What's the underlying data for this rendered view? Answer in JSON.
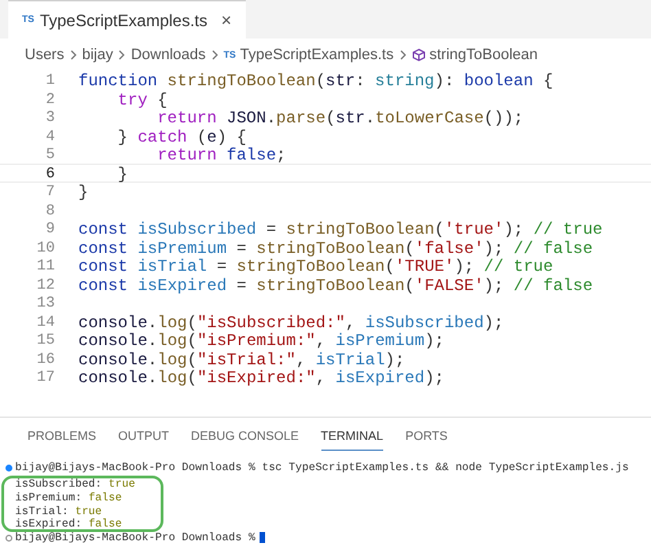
{
  "editor_tab": {
    "icon_text": "TS",
    "label": "TypeScriptExamples.ts",
    "close": "×",
    "selected": true
  },
  "breadcrumb": [
    {
      "kind": "text",
      "label": "Users"
    },
    {
      "kind": "text",
      "label": "bijay"
    },
    {
      "kind": "text",
      "label": "Downloads"
    },
    {
      "kind": "file",
      "icon_text": "TS",
      "label": "TypeScriptExamples.ts"
    },
    {
      "kind": "symbol",
      "label": "stringToBoolean"
    }
  ],
  "code_lines": [
    {
      "number": "1",
      "current": false,
      "tokens": [
        {
          "kind": "kw",
          "text": "function"
        },
        {
          "kind": "fn",
          "text": " stringToBoolean"
        },
        {
          "kind": "plain",
          "text": "("
        },
        {
          "kind": "var",
          "text": "str"
        },
        {
          "kind": "plain",
          "text": ": "
        },
        {
          "kind": "type",
          "text": "string"
        },
        {
          "kind": "plain",
          "text": "): "
        },
        {
          "kind": "kw",
          "text": "boolean"
        },
        {
          "kind": "plain",
          "text": " {"
        }
      ]
    },
    {
      "number": "2",
      "current": false,
      "tokens": [
        {
          "kind": "ctrl",
          "text": "    try"
        },
        {
          "kind": "plain",
          "text": " {"
        }
      ]
    },
    {
      "number": "3",
      "current": false,
      "tokens": [
        {
          "kind": "ctrl",
          "text": "        return"
        },
        {
          "kind": "var",
          "text": " JSON"
        },
        {
          "kind": "plain",
          "text": "."
        },
        {
          "kind": "fn",
          "text": "parse"
        },
        {
          "kind": "plain",
          "text": "("
        },
        {
          "kind": "var",
          "text": "str"
        },
        {
          "kind": "plain",
          "text": "."
        },
        {
          "kind": "fn",
          "text": "toLowerCase"
        },
        {
          "kind": "plain",
          "text": "());"
        }
      ]
    },
    {
      "number": "4",
      "current": false,
      "tokens": [
        {
          "kind": "plain",
          "text": "    } "
        },
        {
          "kind": "ctrl",
          "text": "catch"
        },
        {
          "kind": "plain",
          "text": " ("
        },
        {
          "kind": "var",
          "text": "e"
        },
        {
          "kind": "plain",
          "text": ") {"
        }
      ]
    },
    {
      "number": "5",
      "current": false,
      "tokens": [
        {
          "kind": "ctrl",
          "text": "        return"
        },
        {
          "kind": "kw",
          "text": " false"
        },
        {
          "kind": "plain",
          "text": ";"
        }
      ]
    },
    {
      "number": "6",
      "current": true,
      "tokens": [
        {
          "kind": "plain",
          "text": "    }"
        }
      ]
    },
    {
      "number": "7",
      "current": false,
      "tokens": [
        {
          "kind": "plain",
          "text": "}"
        }
      ]
    },
    {
      "number": "8",
      "current": false
    },
    {
      "number": "9",
      "current": false,
      "tokens": [
        {
          "kind": "kw",
          "text": "const"
        },
        {
          "kind": "const",
          "text": " isSubscribed"
        },
        {
          "kind": "plain",
          "text": " = "
        },
        {
          "kind": "fn",
          "text": "stringToBoolean"
        },
        {
          "kind": "plain",
          "text": "("
        },
        {
          "kind": "str",
          "text": "'true'"
        },
        {
          "kind": "plain",
          "text": "); "
        },
        {
          "kind": "cmt",
          "text": "// true"
        }
      ]
    },
    {
      "number": "10",
      "current": false,
      "tokens": [
        {
          "kind": "kw",
          "text": "const"
        },
        {
          "kind": "const",
          "text": " isPremium"
        },
        {
          "kind": "plain",
          "text": " = "
        },
        {
          "kind": "fn",
          "text": "stringToBoolean"
        },
        {
          "kind": "plain",
          "text": "("
        },
        {
          "kind": "str",
          "text": "'false'"
        },
        {
          "kind": "plain",
          "text": "); "
        },
        {
          "kind": "cmt",
          "text": "// false"
        }
      ]
    },
    {
      "number": "11",
      "current": false,
      "tokens": [
        {
          "kind": "kw",
          "text": "const"
        },
        {
          "kind": "const",
          "text": " isTrial"
        },
        {
          "kind": "plain",
          "text": " = "
        },
        {
          "kind": "fn",
          "text": "stringToBoolean"
        },
        {
          "kind": "plain",
          "text": "("
        },
        {
          "kind": "str",
          "text": "'TRUE'"
        },
        {
          "kind": "plain",
          "text": "); "
        },
        {
          "kind": "cmt",
          "text": "// true"
        }
      ]
    },
    {
      "number": "12",
      "current": false,
      "tokens": [
        {
          "kind": "kw",
          "text": "const"
        },
        {
          "kind": "const",
          "text": " isExpired"
        },
        {
          "kind": "plain",
          "text": " = "
        },
        {
          "kind": "fn",
          "text": "stringToBoolean"
        },
        {
          "kind": "plain",
          "text": "("
        },
        {
          "kind": "str",
          "text": "'FALSE'"
        },
        {
          "kind": "plain",
          "text": "); "
        },
        {
          "kind": "cmt",
          "text": "// false"
        }
      ]
    },
    {
      "number": "13",
      "current": false
    },
    {
      "number": "14",
      "current": false,
      "tokens": [
        {
          "kind": "var",
          "text": "console"
        },
        {
          "kind": "plain",
          "text": "."
        },
        {
          "kind": "fn",
          "text": "log"
        },
        {
          "kind": "plain",
          "text": "("
        },
        {
          "kind": "str",
          "text": "\"isSubscribed:\""
        },
        {
          "kind": "plain",
          "text": ", "
        },
        {
          "kind": "const",
          "text": "isSubscribed"
        },
        {
          "kind": "plain",
          "text": ");"
        }
      ]
    },
    {
      "number": "15",
      "current": false,
      "tokens": [
        {
          "kind": "var",
          "text": "console"
        },
        {
          "kind": "plain",
          "text": "."
        },
        {
          "kind": "fn",
          "text": "log"
        },
        {
          "kind": "plain",
          "text": "("
        },
        {
          "kind": "str",
          "text": "\"isPremium:\""
        },
        {
          "kind": "plain",
          "text": ", "
        },
        {
          "kind": "const",
          "text": "isPremium"
        },
        {
          "kind": "plain",
          "text": ");"
        }
      ]
    },
    {
      "number": "16",
      "current": false,
      "tokens": [
        {
          "kind": "var",
          "text": "console"
        },
        {
          "kind": "plain",
          "text": "."
        },
        {
          "kind": "fn",
          "text": "log"
        },
        {
          "kind": "plain",
          "text": "("
        },
        {
          "kind": "str",
          "text": "\"isTrial:\""
        },
        {
          "kind": "plain",
          "text": ", "
        },
        {
          "kind": "const",
          "text": "isTrial"
        },
        {
          "kind": "plain",
          "text": ");"
        }
      ]
    },
    {
      "number": "17",
      "current": false,
      "tokens": [
        {
          "kind": "var",
          "text": "console"
        },
        {
          "kind": "plain",
          "text": "."
        },
        {
          "kind": "fn",
          "text": "log"
        },
        {
          "kind": "plain",
          "text": "("
        },
        {
          "kind": "str",
          "text": "\"isExpired:\""
        },
        {
          "kind": "plain",
          "text": ", "
        },
        {
          "kind": "const",
          "text": "isExpired"
        },
        {
          "kind": "plain",
          "text": ");"
        }
      ]
    }
  ],
  "panel_tabs": [
    {
      "label": "PROBLEMS",
      "selected": false
    },
    {
      "label": "OUTPUT",
      "selected": false
    },
    {
      "label": "DEBUG CONSOLE",
      "selected": false
    },
    {
      "label": "TERMINAL",
      "selected": true
    },
    {
      "label": "PORTS",
      "selected": false
    }
  ],
  "terminal": [
    {
      "kind": "command",
      "done": true,
      "text": "bijay@Bijays-MacBook-Pro Downloads % tsc TypeScriptExamples.ts && node TypeScriptExamples.js"
    },
    {
      "kind": "output",
      "key": "isSubscribed:",
      "value": "true"
    },
    {
      "kind": "output",
      "key": "isPremium:",
      "value": "false"
    },
    {
      "kind": "output",
      "key": "isTrial:",
      "value": "true"
    },
    {
      "kind": "output",
      "key": "isExpired:",
      "value": "false"
    },
    {
      "kind": "prompt",
      "done": false,
      "text": "bijay@Bijays-MacBook-Pro Downloads %"
    }
  ]
}
